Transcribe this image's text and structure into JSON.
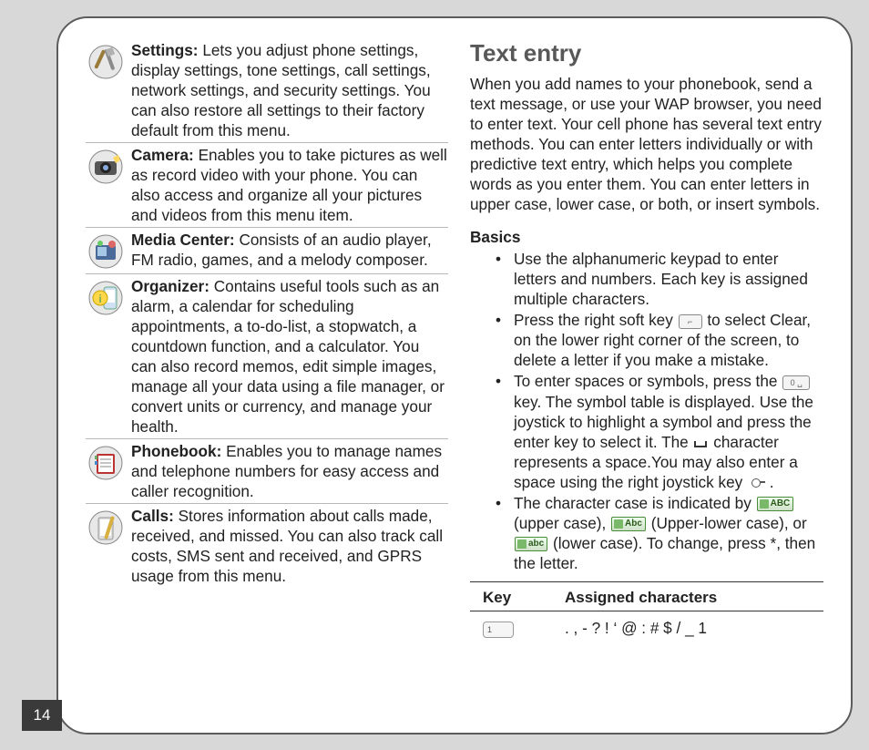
{
  "page_number": "14",
  "left_features": [
    {
      "icon": "settings-icon",
      "label": "Settings:",
      "desc": "Lets you adjust phone settings, display settings, tone settings, call settings, network settings, and security settings. You can also restore all settings to their factory default from this menu."
    },
    {
      "icon": "camera-icon",
      "label": "Camera:",
      "desc": "Enables you to take pictures as well as record video with your phone. You can also access and organize all your pictures and videos from this menu item."
    },
    {
      "icon": "media-center-icon",
      "label": "Media Center:",
      "desc": "Consists of an audio player, FM radio, games, and a melody composer."
    },
    {
      "icon": "organizer-icon",
      "label": "Organizer:",
      "desc": "Contains useful tools such as an alarm, a calendar for scheduling appointments, a to-do-list, a stopwatch, a countdown function, and a calculator. You can also record memos, edit simple images, manage all your data using a file manager, or convert units or currency, and manage your health."
    },
    {
      "icon": "phonebook-icon",
      "label": "Phonebook:",
      "desc": "Enables you to manage names and telephone numbers for easy access and caller recognition."
    },
    {
      "icon": "calls-icon",
      "label": "Calls:",
      "desc": "Stores information about calls made, received, and missed. You can also track call costs, SMS sent and received, and GPRS usage from this menu."
    }
  ],
  "right": {
    "title": "Text entry",
    "intro": "When you add names to your phonebook, send a text message, or use your WAP browser, you need to enter text. Your cell phone has several text entry methods. You can enter letters individually or with predictive text entry, which helps you complete words as you enter them. You can enter letters in upper case, lower case, or both, or insert symbols.",
    "basics_label": "Basics",
    "bullets": {
      "b1": "Use the alphanumeric keypad to enter letters and numbers. Each key is assigned multiple characters.",
      "b2_a": "Press the right soft key ",
      "b2_b": " to select Clear, on the lower right corner of the screen, to delete a letter if you make a mistake.",
      "b3_a": "To enter spaces or symbols, press the ",
      "b3_b": " key. The symbol table is displayed. Use the joystick to highlight a symbol and press the enter key to select it. The ",
      "b3_c": " character represents a space.You may also enter a space using the right joystick key ",
      "b3_d": " .",
      "b4_a": "The character case is indicated by ",
      "b4_upper": "ABC",
      "b4_b": " (upper case), ",
      "b4_mixed": "Abc",
      "b4_c": " (Upper-lower case), or ",
      "b4_lower": "abc",
      "b4_d": " (lower case). To change, press *, then the letter."
    },
    "table": {
      "h1": "Key",
      "h2": "Assigned characters",
      "row1_key": "1",
      "row1_chars": ". , - ? ! ‘ @ : # $ / _  1"
    }
  }
}
